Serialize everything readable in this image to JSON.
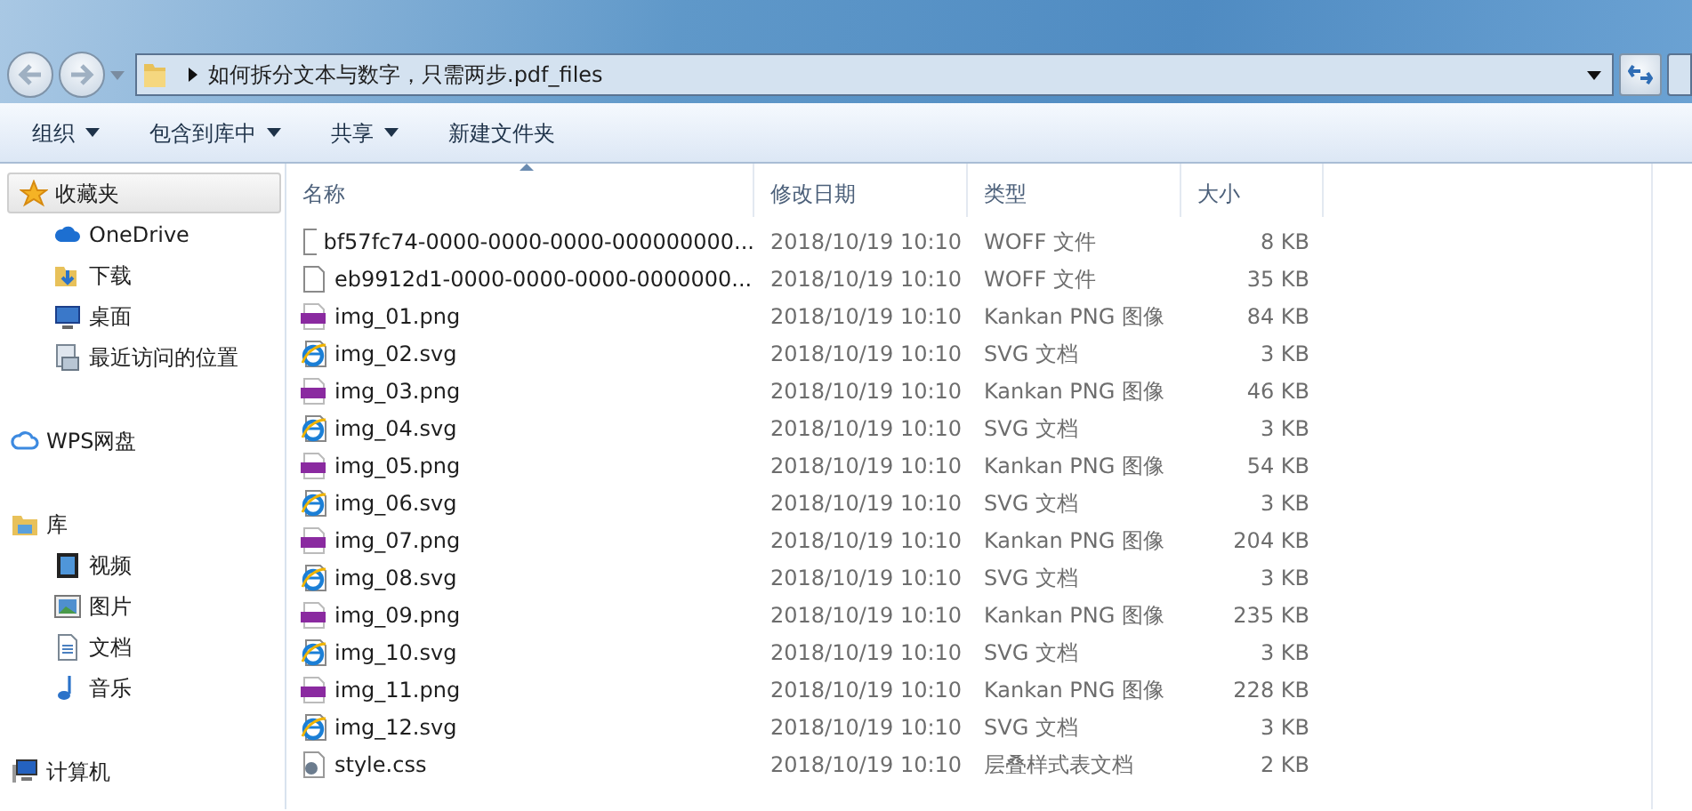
{
  "address_bar": {
    "path": "如何拆分文本与数字，只需两步.pdf_files"
  },
  "toolbar": [
    {
      "label": "组织",
      "dropdown": true
    },
    {
      "label": "包含到库中",
      "dropdown": true
    },
    {
      "label": "共享",
      "dropdown": true
    },
    {
      "label": "新建文件夹",
      "dropdown": false
    }
  ],
  "sidebar": [
    {
      "label": "收藏夹",
      "kind": "star",
      "selected": true,
      "children": [
        {
          "label": "OneDrive",
          "kind": "cloud"
        },
        {
          "label": "下载",
          "kind": "download"
        },
        {
          "label": "桌面",
          "kind": "desktop"
        },
        {
          "label": "最近访问的位置",
          "kind": "recent"
        }
      ]
    },
    {
      "label": "WPS网盘",
      "kind": "wps",
      "selected": false
    },
    {
      "label": "库",
      "kind": "library",
      "selected": false,
      "children": [
        {
          "label": "视频",
          "kind": "video"
        },
        {
          "label": "图片",
          "kind": "image"
        },
        {
          "label": "文档",
          "kind": "doc"
        },
        {
          "label": "音乐",
          "kind": "music"
        }
      ]
    },
    {
      "label": "计算机",
      "kind": "computer",
      "selected": false
    }
  ],
  "table": {
    "columns": [
      {
        "label": "名称",
        "sorted": true
      },
      {
        "label": "修改日期",
        "sorted": false
      },
      {
        "label": "类型",
        "sorted": false
      },
      {
        "label": "大小",
        "sorted": false
      }
    ],
    "rows": [
      {
        "kind": "blank",
        "name": "bf57fc74-0000-0000-0000-000000000...",
        "date": "2018/10/19 10:10",
        "type": "WOFF 文件",
        "size": "8 KB"
      },
      {
        "kind": "blank",
        "name": "eb9912d1-0000-0000-0000-0000000...",
        "date": "2018/10/19 10:10",
        "type": "WOFF 文件",
        "size": "35 KB"
      },
      {
        "kind": "png",
        "name": "img_01.png",
        "date": "2018/10/19 10:10",
        "type": "Kankan PNG 图像",
        "size": "84 KB"
      },
      {
        "kind": "svg",
        "name": "img_02.svg",
        "date": "2018/10/19 10:10",
        "type": "SVG 文档",
        "size": "3 KB"
      },
      {
        "kind": "png",
        "name": "img_03.png",
        "date": "2018/10/19 10:10",
        "type": "Kankan PNG 图像",
        "size": "46 KB"
      },
      {
        "kind": "svg",
        "name": "img_04.svg",
        "date": "2018/10/19 10:10",
        "type": "SVG 文档",
        "size": "3 KB"
      },
      {
        "kind": "png",
        "name": "img_05.png",
        "date": "2018/10/19 10:10",
        "type": "Kankan PNG 图像",
        "size": "54 KB"
      },
      {
        "kind": "svg",
        "name": "img_06.svg",
        "date": "2018/10/19 10:10",
        "type": "SVG 文档",
        "size": "3 KB"
      },
      {
        "kind": "png",
        "name": "img_07.png",
        "date": "2018/10/19 10:10",
        "type": "Kankan PNG 图像",
        "size": "204 KB"
      },
      {
        "kind": "svg",
        "name": "img_08.svg",
        "date": "2018/10/19 10:10",
        "type": "SVG 文档",
        "size": "3 KB"
      },
      {
        "kind": "png",
        "name": "img_09.png",
        "date": "2018/10/19 10:10",
        "type": "Kankan PNG 图像",
        "size": "235 KB"
      },
      {
        "kind": "svg",
        "name": "img_10.svg",
        "date": "2018/10/19 10:10",
        "type": "SVG 文档",
        "size": "3 KB"
      },
      {
        "kind": "png",
        "name": "img_11.png",
        "date": "2018/10/19 10:10",
        "type": "Kankan PNG 图像",
        "size": "228 KB"
      },
      {
        "kind": "svg",
        "name": "img_12.svg",
        "date": "2018/10/19 10:10",
        "type": "SVG 文档",
        "size": "3 KB"
      },
      {
        "kind": "css",
        "name": "style.css",
        "date": "2018/10/19 10:10",
        "type": "层叠样式表文档",
        "size": "2 KB"
      }
    ]
  }
}
